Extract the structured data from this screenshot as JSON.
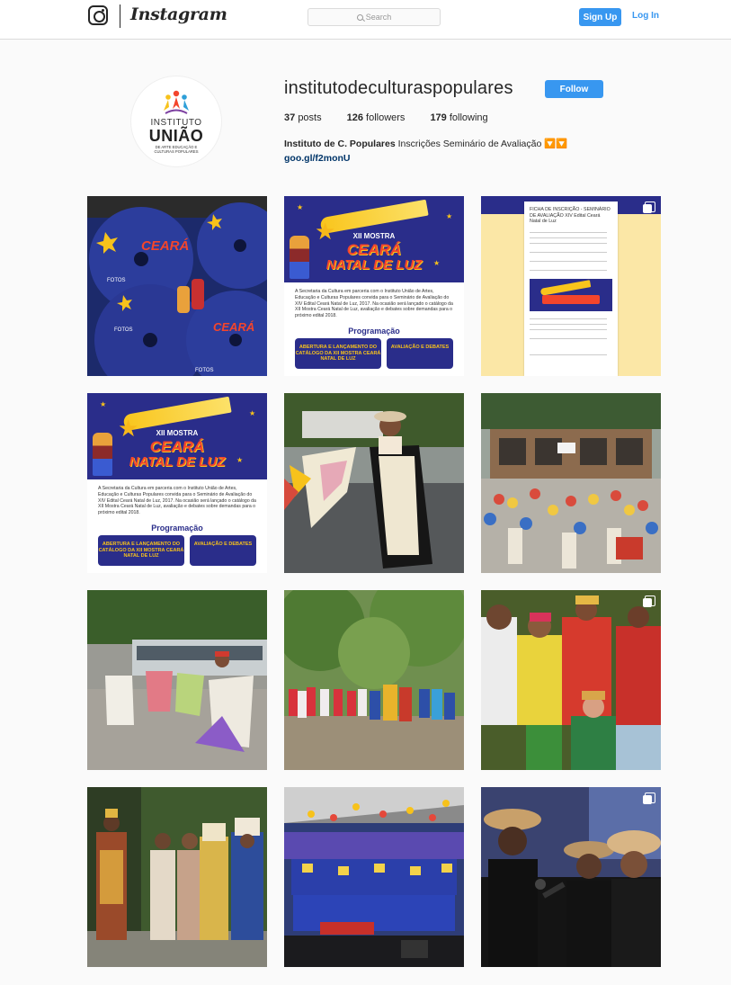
{
  "header": {
    "brand": "Instagram",
    "search_placeholder": "Search",
    "signup_label": "Sign Up",
    "login_label": "Log In"
  },
  "profile": {
    "username": "institutodeculturaspopulares",
    "follow_label": "Follow",
    "posts_count": "37",
    "posts_label": "posts",
    "followers_count": "126",
    "followers_label": "followers",
    "following_count": "179",
    "following_label": "following",
    "bio_name": "Instituto de C. Populares",
    "bio_text": " Inscrições Seminário de Avaliação",
    "bio_emoji": "🔽🔽",
    "link": "goo.gl/f2monU",
    "avatar": {
      "line1": "INSTITUTO",
      "line2": "UNIÃO",
      "line3": "DE ARTE EDUCAÇÃO E",
      "line4": "CULTURAS POPULARES"
    }
  },
  "posters": {
    "line1": "XII MOSTRA",
    "line2": "CEARÁ",
    "line3": "NATAL DE LUZ",
    "paragraph": "A Secretaria da Cultura em parceria com o Instituto União de Artes, Educação e Culturas Populares convida para o Seminário de Avaliação do XIV Edital Ceará Natal de Luz, 2017. Na ocasião será lançado o catálogo da XII Mostra Ceará Natal de Luz, avaliação e debates sobre demandas para o próximo edital 2018.",
    "programacao": "Programação",
    "box1": "ABERTURA E LANÇAMENTO DO CATÁLOGO DA XII MOSTRA CEARÁ NATAL DE LUZ",
    "box2": "AVALIAÇÃO E DEBATES"
  },
  "form_tile": {
    "heading": "FICHA DE INSCRIÇÃO - SEMINÁRIO DE AVALIAÇÃO XIV Edital Ceará Natal de Luz"
  },
  "grid": {
    "tiles": [
      {
        "kind": "photo",
        "subject": "dvd-discs-fotos",
        "multi": false
      },
      {
        "kind": "poster",
        "subject": "poster-xii-mostra",
        "multi": false
      },
      {
        "kind": "form",
        "subject": "ficha-de-inscricao",
        "multi": true
      },
      {
        "kind": "poster",
        "subject": "poster-xii-mostra",
        "multi": false
      },
      {
        "kind": "photo",
        "subject": "costumed-dancer-flag",
        "multi": false
      },
      {
        "kind": "photo",
        "subject": "street-parade",
        "multi": false
      },
      {
        "kind": "photo",
        "subject": "flag-bearers-street",
        "multi": false
      },
      {
        "kind": "photo",
        "subject": "group-in-park",
        "multi": false
      },
      {
        "kind": "photo",
        "subject": "festive-costumes",
        "multi": true
      },
      {
        "kind": "photo",
        "subject": "wise-men-costumes",
        "multi": false
      },
      {
        "kind": "photo",
        "subject": "stage-group",
        "multi": false
      },
      {
        "kind": "photo",
        "subject": "singers-microphone",
        "multi": true
      }
    ]
  },
  "colors": {
    "accent": "#3897f0",
    "border": "#dbdbdb",
    "poster_blue": "#2a2d8a",
    "poster_yellow": "#f7c21b",
    "poster_red": "#f3452c"
  }
}
